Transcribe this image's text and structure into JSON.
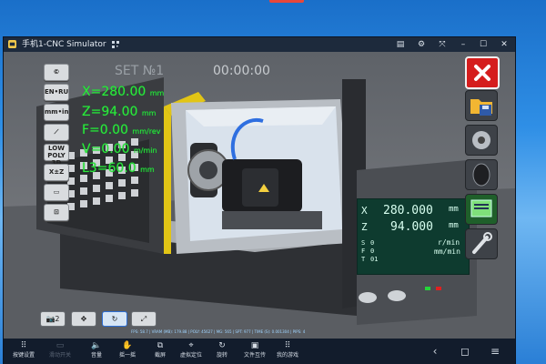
{
  "window": {
    "title": "手机1-CNC Simulator"
  },
  "titlebar_buttons": [
    "chat-icon",
    "gear-icon",
    "fullscreen-icon",
    "minimize-icon",
    "maximize-icon",
    "close-icon"
  ],
  "hud": {
    "set_label": "SET №1",
    "timer": "00:00:00",
    "left_buttons": [
      "©",
      "EN•RU",
      "mm•in",
      "⟋",
      "LOW POLY 3D",
      "X±Z",
      "▭",
      "⊡"
    ]
  },
  "readouts": {
    "x": {
      "label": "X=280.00",
      "unit": "mm"
    },
    "z": {
      "label": "Z=94.00",
      "unit": "mm"
    },
    "f": {
      "label": "F=0.00",
      "unit": "mm/rev"
    },
    "v": {
      "label": "V=0.00",
      "unit": "m/min"
    },
    "l": {
      "label": "L3=60.0",
      "unit": "mm"
    }
  },
  "lcd": {
    "x_label": "X",
    "x_value": "280.000",
    "x_unit": "mm",
    "z_label": "Z",
    "z_value": "94.000",
    "z_unit": "mm",
    "s_label": "S",
    "s_value": "0",
    "s_unit": "r/min",
    "f_label": "F",
    "f_value": "0",
    "f_unit": "mm/min",
    "t_label": "T",
    "t_value": "01"
  },
  "bottom_controls": [
    "📷2",
    "✥",
    "↻",
    "⤢"
  ],
  "status_line": "FPS: 58.7 | VRAM (MB): 179.88 | POLY: 45627 | MG: 565 | SPT: 977 | TIME (S): 0.001304 | PIPS: 4",
  "taskbar": [
    {
      "icon": "⠿",
      "label": "按键设置",
      "dim": false
    },
    {
      "icon": "▭",
      "label": "滑动开关",
      "dim": true
    },
    {
      "icon": "🔈",
      "label": "音量",
      "dim": false
    },
    {
      "icon": "✋",
      "label": "摇一摇",
      "dim": false
    },
    {
      "icon": "⧉",
      "label": "截屏",
      "dim": false
    },
    {
      "icon": "⌖",
      "label": "虚拟定位",
      "dim": false
    },
    {
      "icon": "↻",
      "label": "旋转",
      "dim": false
    },
    {
      "icon": "▣",
      "label": "文件互传",
      "dim": false
    },
    {
      "icon": "⠿",
      "label": "我的游戏",
      "dim": false
    }
  ],
  "nav": [
    "‹",
    "◻",
    "≡"
  ]
}
